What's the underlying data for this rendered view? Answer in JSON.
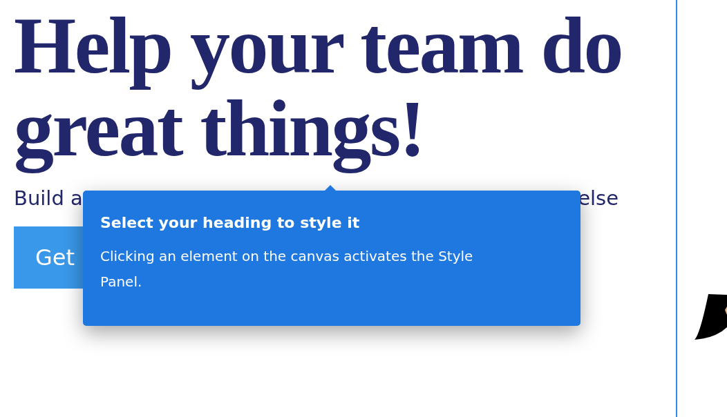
{
  "hero": {
    "heading_lines": [
      "Help your team do",
      "great things!"
    ],
    "subtitle_start": "Build a",
    "subtitle_end": "else",
    "cta_button": "Get"
  },
  "tooltip": {
    "title": "Select your heading to style it",
    "body": "Clicking an element on the canvas activates the Style Panel."
  }
}
